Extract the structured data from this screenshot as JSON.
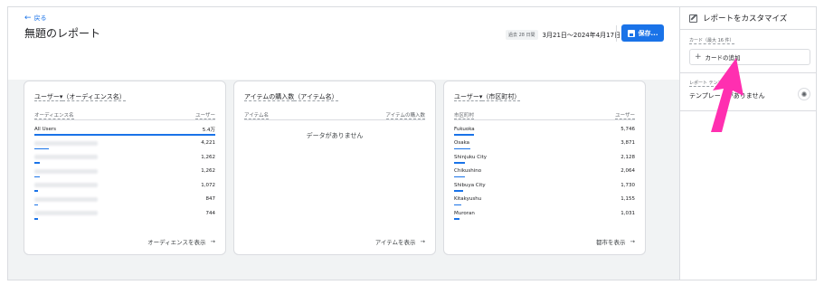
{
  "header": {
    "back_label": "戻る",
    "title": "無題のレポート",
    "date_chip": "過去 28 日間",
    "date_range": "3月21日～2024年4月17日",
    "save_label": "保存..."
  },
  "cards": [
    {
      "title_prefix": "ユーザー▾",
      "title_dim": "（オーディエンス名）",
      "col1": "オーディエンス名",
      "col2": "ユーザー",
      "rows": [
        {
          "label": "All Users",
          "value": "5.4万",
          "share": 1.0
        },
        {
          "label": "",
          "value": "4,221",
          "share": 0.08
        },
        {
          "label": "",
          "value": "1,262",
          "share": 0.03
        },
        {
          "label": "",
          "value": "1,262",
          "share": 0.03
        },
        {
          "label": "",
          "value": "1,072",
          "share": 0.02
        },
        {
          "label": "",
          "value": "847",
          "share": 0.02
        },
        {
          "label": "",
          "value": "744",
          "share": 0.01
        }
      ],
      "footer": "オーディエンスを表示"
    },
    {
      "title_prefix": "アイテムの購入数",
      "title_dim": "（アイテム名）",
      "col1": "アイテム名",
      "col2": "アイテムの購入数",
      "empty_text": "データがありません",
      "footer": "アイテムを表示"
    },
    {
      "title_prefix": "ユーザー▾",
      "title_dim": "（市区町村）",
      "col1": "市区町村",
      "col2": "ユーザー",
      "rows": [
        {
          "label": "Fukuoka",
          "value": "5,746",
          "share": 0.11
        },
        {
          "label": "Osaka",
          "value": "3,871",
          "share": 0.09
        },
        {
          "label": "Shinjuku City",
          "value": "2,128",
          "share": 0.06
        },
        {
          "label": "Chikushino",
          "value": "2,064",
          "share": 0.06
        },
        {
          "label": "Shibuya City",
          "value": "1,730",
          "share": 0.05
        },
        {
          "label": "Kitakyushu",
          "value": "1,155",
          "share": 0.04
        },
        {
          "label": "Muroran",
          "value": "1,031",
          "share": 0.03
        }
      ],
      "footer": "都市を表示"
    }
  ],
  "side": {
    "title": "レポートをカスタマイズ",
    "cards_limit": "カード（最大 16 件）",
    "add_card": "カードの追加",
    "templates_label": "レポート テンプレート",
    "no_templates": "テンプレートがありません"
  },
  "colors": {
    "accent": "#1a73e8",
    "pointer": "#ff2fb0"
  }
}
